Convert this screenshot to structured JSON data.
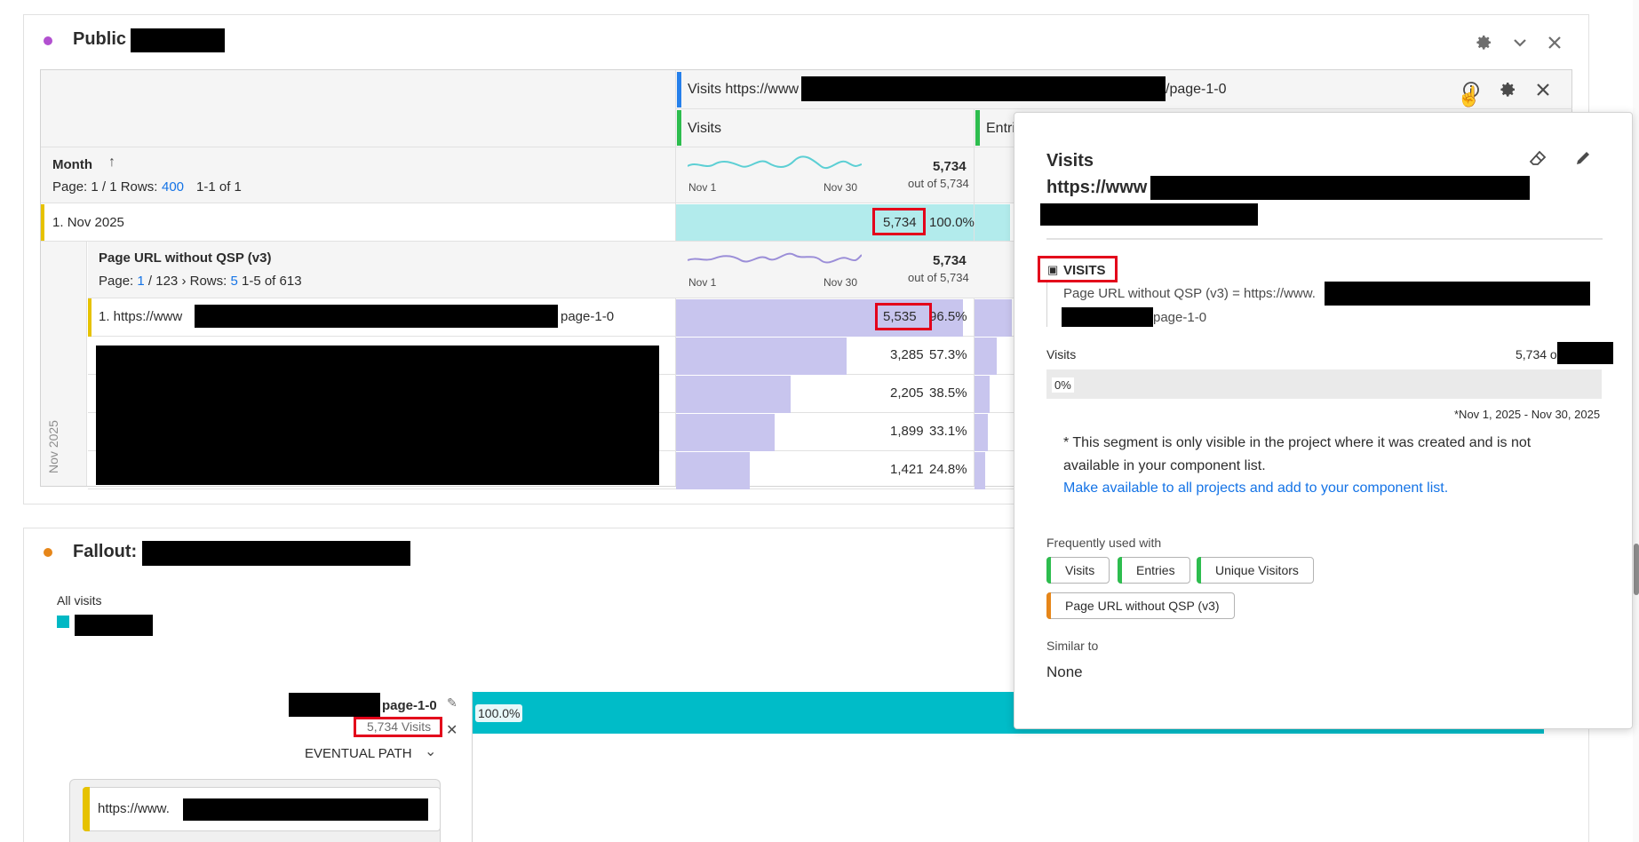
{
  "panel1": {
    "title": "Public",
    "dot_color": "#b250d0",
    "table": {
      "segment_header": "Visits https://www",
      "segment_header_suffix": "/page-1-0",
      "col_visits": "Visits",
      "col_entries": "Entri",
      "month_label": "Month",
      "sort_icon": "arrow-up-icon",
      "page_info": {
        "prefix": "Page: 1 / 1  Rows:",
        "rows": "400",
        "range": "1-1 of 1"
      },
      "spark_start": "Nov 1",
      "spark_end": "Nov 30",
      "total": "5,734",
      "out_of": "out of 5,734",
      "row1": {
        "index": "1.",
        "label": "Nov 2025",
        "value": "5,734",
        "pct": "100.0%"
      },
      "sub": {
        "label": "Page URL without QSP (v3)",
        "page_prefix": "Page:",
        "page_current": "1",
        "page_total": "/ 123",
        "rows_label": "Rows:",
        "rows_value": "5",
        "range": "1-5 of 613",
        "total": "5,734",
        "out_of": "out of 5,734",
        "vertical_label": "Nov 2025",
        "rows": [
          {
            "index": "1.",
            "label_prefix": "https://www",
            "label_suffix": "page-1-0",
            "value": "5,535",
            "pct": "96.5%",
            "fill": 0.965
          },
          {
            "value": "3,285",
            "pct": "57.3%",
            "fill": 0.573
          },
          {
            "value": "2,205",
            "pct": "38.5%",
            "fill": 0.385
          },
          {
            "value": "1,899",
            "pct": "33.1%",
            "fill": 0.331
          },
          {
            "value": "1,421",
            "pct": "24.8%",
            "fill": 0.248
          }
        ]
      }
    }
  },
  "panel2": {
    "title": "Fallout:",
    "dot_color": "#e68619",
    "all_visits": "All visits",
    "legend_color": "#00b8c4",
    "step_label": "page-1-0",
    "step_visits": "5,734 Visits",
    "bar_pct": "100.0%",
    "eventual_path": "EVENTUAL PATH",
    "next_step_prefix": "https://www."
  },
  "popover": {
    "title_line1": "Visits",
    "title_line2": "https://www",
    "section_label": "VISITS",
    "definition_prefix": "Page URL without QSP (v3) = https://www.",
    "definition_suffix": "page-1-0",
    "metric_label": "Visits",
    "metric_value": "5,734 of",
    "bar_pct": "0%",
    "date_range": "*Nov 1, 2025 - Nov 30, 2025",
    "note": "* This segment is only visible in the project where it was created and is not available in your component list.",
    "link": "Make available to all projects and add to your component list.",
    "freq_label": "Frequently used with",
    "chips": [
      {
        "label": "Visits",
        "color": "#2dbd4e"
      },
      {
        "label": "Entries",
        "color": "#2dbd4e"
      },
      {
        "label": "Unique Visitors",
        "color": "#2dbd4e"
      },
      {
        "label": "Page URL without QSP (v3)",
        "color": "#e68619"
      }
    ],
    "similar_label": "Similar to",
    "similar_value": "None"
  },
  "colors": {
    "teal_fill": "#b2ebec",
    "purple_fill": "#c8c5ee",
    "accent_blue": "#1473e6",
    "fallout_bar": "#00bcc8"
  }
}
